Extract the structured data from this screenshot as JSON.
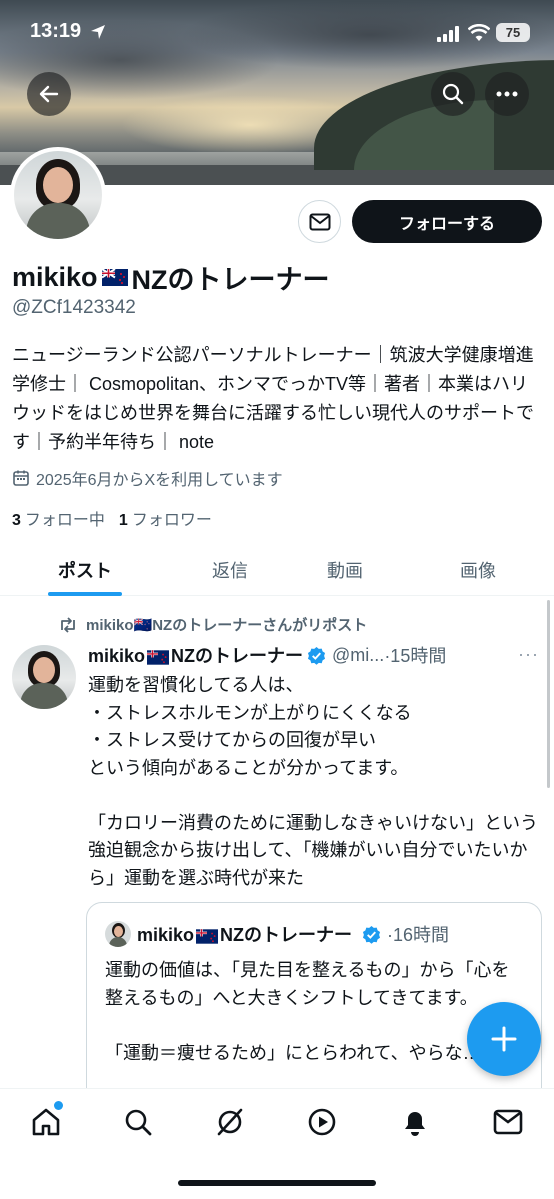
{
  "status": {
    "time": "13:19",
    "battery": "75"
  },
  "profile": {
    "name_prefix": "mikiko",
    "name_suffix": "NZのトレーナー",
    "handle": "@ZCf1423342",
    "bio": "ニュージーランド公認パーソナルトレーナー｜筑波大学健康増進学修士｜ Cosmopolitan、ホンマでっかTV等｜著者｜本業はハリウッドをはじめ世界を舞台に活躍する忙しい現代人のサポートです｜予約半年待ち｜ note",
    "joined": "2025年6月からXを利用しています",
    "following_count": "3",
    "following_label": "フォロー中",
    "followers_count": "1",
    "followers_label": "フォロワー",
    "follow_button": "フォローする"
  },
  "tabs": [
    "ポスト",
    "返信",
    "動画",
    "画像"
  ],
  "post": {
    "repost_label": "mikiko🇳🇿NZのトレーナーさんがリポスト",
    "author_prefix": "mikiko",
    "author_suffix": "NZのトレーナー",
    "handle": "@mi...",
    "time": "·15時間",
    "more": "···",
    "text": "運動を習慣化してる人は、\n・ストレスホルモンが上がりにくくなる\n・ストレス受けてからの回復が早い\nという傾向があることが分かってます。\n\n「カロリー消費のために運動しなきゃいけない」という強迫観念から抜け出して、「機嫌がいい自分でいたいから」運動を選ぶ時代が来た"
  },
  "quote": {
    "author_prefix": "mikiko",
    "author_suffix": "NZのトレーナー",
    "time": "·16時間",
    "text": "運動の価値は、「見た目を整えるもの」から「心を整えるもの」へと大きくシフトしてきてます。\n\n「運動＝痩せるため」にとらわれて、やらな…"
  },
  "nav": [
    "home-icon",
    "search-icon",
    "grok-icon",
    "video-icon",
    "notifications-icon",
    "messages-icon"
  ],
  "colors": {
    "accent": "#1d9bf0",
    "text": "#0f1419",
    "muted": "#536471"
  }
}
